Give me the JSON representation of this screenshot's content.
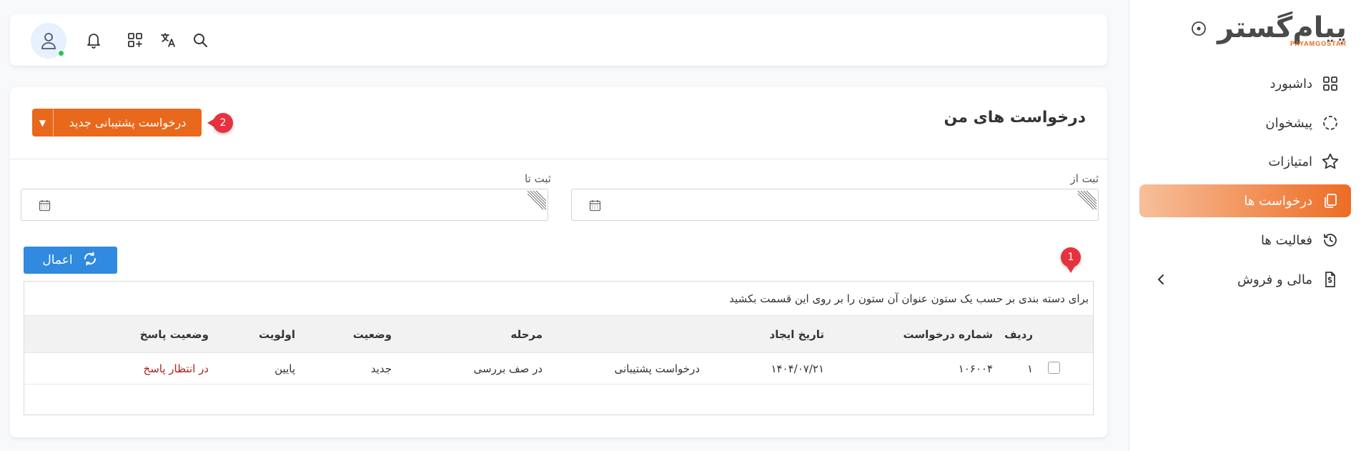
{
  "sidebar": {
    "logo_text": "پیام‌گستر",
    "logo_sub": "PAYAMGOSTAR",
    "items": [
      {
        "label": "داشبورد",
        "icon": "grid-icon"
      },
      {
        "label": "پیشخوان",
        "icon": "dashed-circle-icon"
      },
      {
        "label": "امتیازات",
        "icon": "star-icon"
      },
      {
        "label": "درخواست ها",
        "icon": "copy-icon",
        "active": true
      },
      {
        "label": "فعالیت ها",
        "icon": "history-icon"
      },
      {
        "label": "مالی و فروش",
        "icon": "invoice-icon",
        "has_submenu": true
      }
    ]
  },
  "topbar": {
    "icons": [
      "search-icon",
      "translate-icon",
      "apps-add-icon",
      "bell-icon",
      "user-avatar-icon"
    ]
  },
  "page": {
    "title": "درخواست های من",
    "new_button": "درخواست پشتیبانی جدید",
    "badge_new": "2",
    "badge_grid": "1"
  },
  "filters": {
    "from_label": "ثبت از",
    "to_label": "ثبت تا",
    "from_value": "",
    "to_value": ""
  },
  "apply_label": "اعمال",
  "grid": {
    "group_hint": "برای دسته بندی بر حسب یک ستون عنوان آن ستون را بر روی این قسمت بکشید",
    "columns": [
      "ردیف",
      "شماره درخواست",
      "تاریخ ایجاد",
      "",
      "مرحله",
      "وضعیت",
      "اولویت",
      "وضعیت پاسخ"
    ],
    "rows": [
      [
        "۱",
        "۱۰۶۰۰۴",
        "۱۴۰۴/۰۷/۲۱",
        "درخواست پشتیبانی",
        "در صف بررسی",
        "جدید",
        "پایین",
        "در انتظار پاسخ"
      ]
    ]
  },
  "colors": {
    "accent": "#e8691c",
    "primary_blue": "#2f8ae0",
    "badge": "#e5323f",
    "waiting": "#b02020"
  }
}
